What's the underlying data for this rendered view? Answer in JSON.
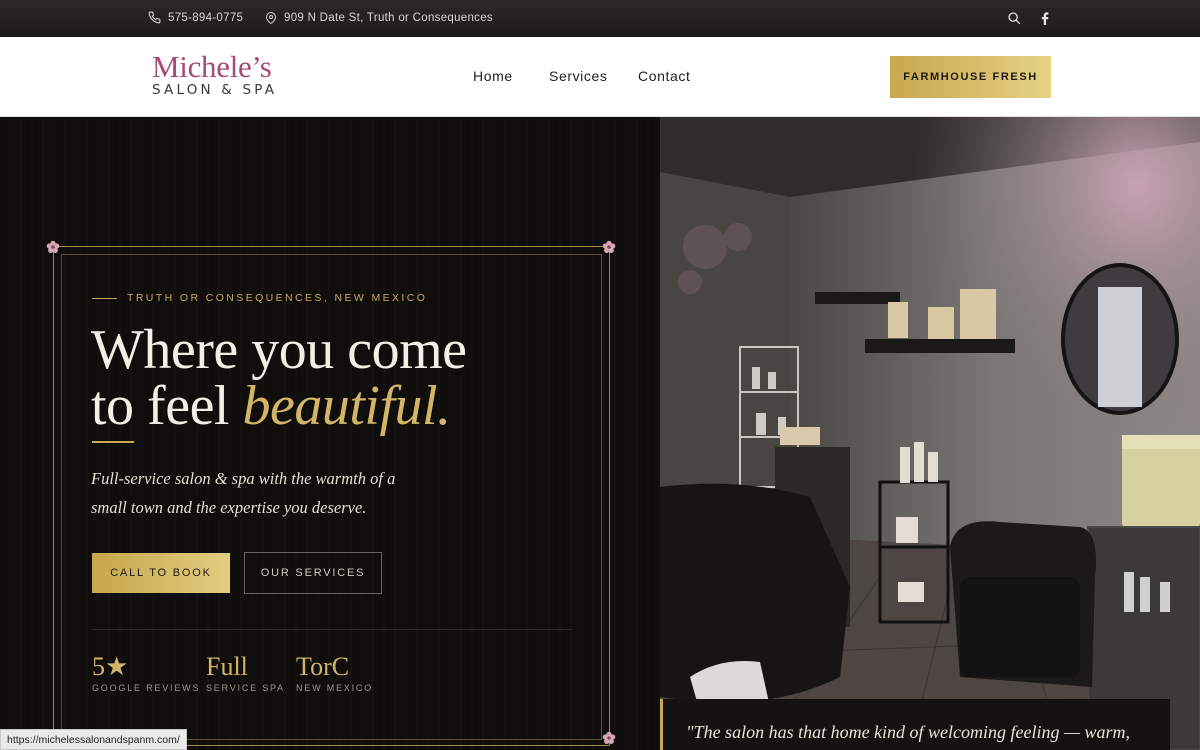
{
  "topbar": {
    "phone": "575-894-0775",
    "address": "909 N Date St, Truth or Consequences",
    "icons": [
      "phone-icon",
      "map-pin-icon",
      "search-icon",
      "facebook-icon"
    ]
  },
  "header": {
    "logo_name": "Michele’s",
    "logo_sub": "SALON & SPA",
    "nav": [
      "Home",
      "Services",
      "Contact"
    ],
    "cta": "FARMHOUSE FRESH"
  },
  "hero": {
    "eyebrow": "TRUTH OR CONSEQUENCES, NEW MEXICO",
    "headline_line1": "Where you come",
    "headline_line2_plain": "to feel",
    "headline_line2_accent": "beautiful.",
    "lede": "Full-service salon & spa with the warmth of a small town and the expertise you deserve.",
    "btn_book": "CALL TO BOOK",
    "btn_services": "OUR SERVICES",
    "stats": [
      {
        "big": "5★",
        "small": "GOOGLE REVIEWS"
      },
      {
        "big": "Full",
        "small": "SERVICE SPA"
      },
      {
        "big": "TorC",
        "small": "NEW MEXICO"
      }
    ],
    "quote": "\"The salon has that home kind of welcoming feeling — warm,"
  },
  "colors": {
    "gold": "#c9a85a",
    "logo_pink": "#a64b73",
    "dark_bg": "#0f0e0d",
    "flower_pink": "#d9a7b4"
  },
  "status_bar": {
    "url": "https://michelessalonandspanm.com/"
  }
}
